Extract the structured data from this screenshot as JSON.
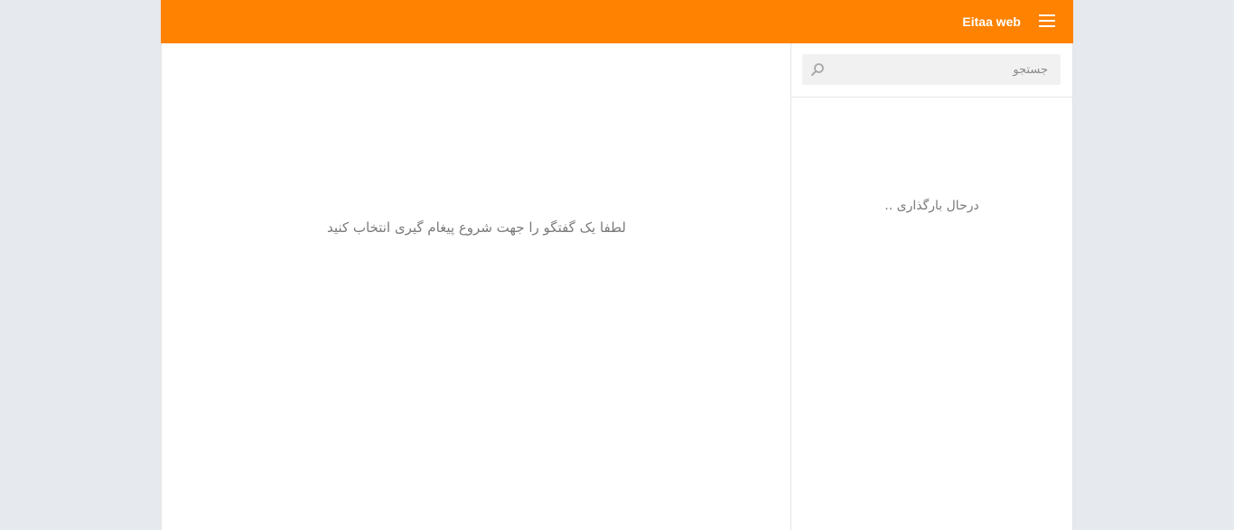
{
  "header": {
    "brand": "Eitaa web",
    "menu_icon": "hamburger-menu-icon"
  },
  "search": {
    "placeholder": "جستجو",
    "icon": "search-icon"
  },
  "sidebar": {
    "loading_text": "درحال بارگذاری .."
  },
  "chat": {
    "empty_message": "لطفا یک گفتگو را جهت شروع پیغام گیری انتخاب کنید"
  },
  "colors": {
    "brand": "#ff8201",
    "background": "#e6e9ed"
  }
}
